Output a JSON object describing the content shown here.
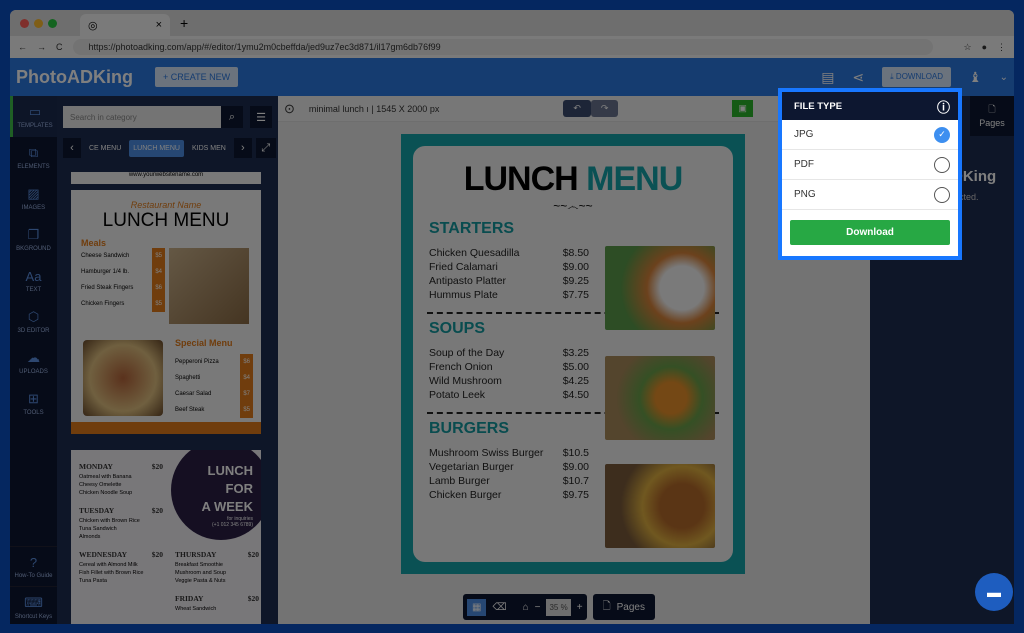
{
  "browser": {
    "url": "https://photoadking.com/app/#/editor/1ymu2m0cbeffda/jed9uz7ec3d871/il17gm6db76f99",
    "tab_close": "×",
    "new_tab": "+"
  },
  "header": {
    "logo": "PhotoADKing",
    "create_new": "+ CREATE NEW",
    "download": "DOWNLOAD"
  },
  "sidebar": {
    "items": [
      {
        "label": "TEMPLATES",
        "icon": "template-icon"
      },
      {
        "label": "ELEMENTS",
        "icon": "elements-icon"
      },
      {
        "label": "IMAGES",
        "icon": "image-icon"
      },
      {
        "label": "BKGROUND",
        "icon": "background-icon"
      },
      {
        "label": "TEXT",
        "icon": "text-icon"
      },
      {
        "label": "3D EDITOR",
        "icon": "cube-icon"
      },
      {
        "label": "UPLOADS",
        "icon": "upload-icon"
      },
      {
        "label": "TOOLS",
        "icon": "toolbox-icon"
      }
    ],
    "how_to": "How-To Guide",
    "shortcut": "Shortcut Keys"
  },
  "panel": {
    "search_placeholder": "Search in category",
    "categories": [
      "CE MENU",
      "LUNCH MENU",
      "KIDS MEN"
    ],
    "thumb0": "www.yourwebsitename.com",
    "thumb1": {
      "restaurant": "Restaurant Name",
      "title": "LUNCH MENU",
      "meals": "Meals",
      "meal_items": [
        [
          "Cheese Sandwich",
          "$5"
        ],
        [
          "Hamburger 1/4 lb.",
          "$4"
        ],
        [
          "Fried Steak Fingers",
          "$6"
        ],
        [
          "Chicken Fingers",
          "$5"
        ]
      ],
      "special": "Special Menu",
      "special_items": [
        [
          "Pepperoni Pizza",
          "$6"
        ],
        [
          "Spaghetti",
          "$4"
        ],
        [
          "Caesar Salad",
          "$7"
        ],
        [
          "Beef Steak",
          "$5"
        ]
      ]
    },
    "thumb2": {
      "circle1": "LUNCH",
      "circle2": "FOR",
      "circle3": "A WEEK",
      "inq": "for inquiries",
      "phone": "(+1 012 345 6789)",
      "days": [
        {
          "day": "MONDAY",
          "price": "$20",
          "items": "Oatmeal with Banana\nCheesy Omelette\nChicken Noodle Soup"
        },
        {
          "day": "TUESDAY",
          "price": "$20",
          "items": "Chicken with Brown Rice\nTuna Sandwich\nAlmonds"
        },
        {
          "day": "WEDNESDAY",
          "price": "$20",
          "items": "Cereal with Almond Milk\nFish Fillet with Brown Rice\nTuna Pasta"
        },
        {
          "day": "THURSDAY",
          "price": "$20",
          "items": "Breakfast Smoothie\nMushroom and Soup\nVeggie Pasta & Nuts"
        },
        {
          "day": "FRIDAY",
          "price": "$20",
          "items": "Wheat Sandwich"
        }
      ]
    }
  },
  "canvas": {
    "doc_title": "minimal lunch ı | 1545 X 2000 px",
    "menu_title_a": "LUNCH",
    "menu_title_b": "MENU",
    "sections": [
      {
        "name": "STARTERS",
        "items": [
          [
            "Chicken Quesadilla",
            "$8.50"
          ],
          [
            "Fried Calamari",
            "$9.00"
          ],
          [
            "Antipasto Platter",
            "$9.25"
          ],
          [
            "Hummus Plate",
            "$7.75"
          ]
        ]
      },
      {
        "name": "SOUPS",
        "items": [
          [
            "Soup of the Day",
            "$3.25"
          ],
          [
            "French Onion",
            "$5.00"
          ],
          [
            "Wild Mushroom",
            "$4.25"
          ],
          [
            "Potato Leek",
            "$4.50"
          ]
        ]
      },
      {
        "name": "BURGERS",
        "items": [
          [
            "Mushroom Swiss Burger",
            "$10.5"
          ],
          [
            "Vegetarian Burger",
            "$9.00"
          ],
          [
            "Lamb Burger",
            "$10.7"
          ],
          [
            "Chicken Burger",
            "$9.75"
          ]
        ]
      }
    ],
    "zoom": "35 %",
    "pages": "Pages"
  },
  "right_panel": {
    "pages": "Pages",
    "brand": "DKing",
    "note": "lected."
  },
  "popup": {
    "title": "FILE TYPE",
    "options": [
      {
        "label": "JPG",
        "selected": true
      },
      {
        "label": "PDF",
        "selected": false
      },
      {
        "label": "PNG",
        "selected": false
      }
    ],
    "download": "Download"
  },
  "colors": {
    "accent": "#1877ff",
    "teal": "#14a3a8",
    "green": "#27a844"
  }
}
